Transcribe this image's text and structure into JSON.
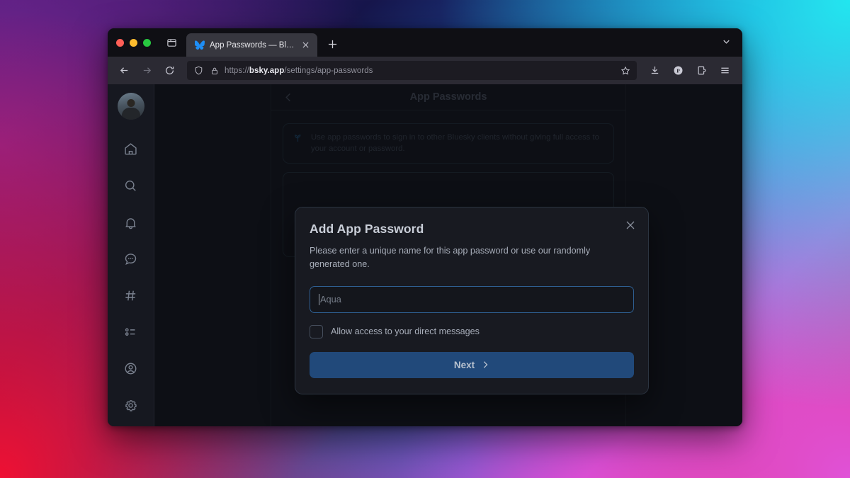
{
  "browser": {
    "traffic_lights": [
      "close",
      "minimize",
      "maximize"
    ],
    "sidebar_toggle_icon": "sidebar-panel-icon",
    "tab": {
      "favicon": "bluesky-butterfly-icon",
      "title": "App Passwords — Bluesky",
      "close_icon": "close-icon"
    },
    "new_tab_label": "+",
    "tab_list_icon": "chevron-down-icon",
    "nav": {
      "back_icon": "arrow-left-icon",
      "forward_icon": "arrow-right-icon",
      "reload_icon": "reload-icon"
    },
    "url": {
      "shield_icon": "shield-icon",
      "lock_icon": "lock-icon",
      "scheme": "https://",
      "host": "bsky.app",
      "path": "/settings/app-passwords",
      "bookmark_icon": "star-icon"
    },
    "toolbar_icons": [
      {
        "name": "download-icon",
        "glyph": "download"
      },
      {
        "name": "pocket-icon",
        "glyph": "P"
      },
      {
        "name": "extensions-icon",
        "glyph": "extension"
      },
      {
        "name": "app-menu-icon",
        "glyph": "hamburger"
      }
    ]
  },
  "sidebar": {
    "avatar_alt": "user-avatar",
    "items": [
      {
        "name": "sidebar-item-home",
        "icon": "home-icon"
      },
      {
        "name": "sidebar-item-search",
        "icon": "search-icon"
      },
      {
        "name": "sidebar-item-notifications",
        "icon": "bell-icon"
      },
      {
        "name": "sidebar-item-chat",
        "icon": "chat-bubble-icon"
      },
      {
        "name": "sidebar-item-feeds",
        "icon": "hashtag-icon"
      },
      {
        "name": "sidebar-item-lists",
        "icon": "list-icon"
      },
      {
        "name": "sidebar-item-profile",
        "icon": "person-circle-icon"
      },
      {
        "name": "sidebar-item-settings",
        "icon": "gear-icon"
      }
    ]
  },
  "page": {
    "back_icon": "chevron-left-icon",
    "title": "App Passwords",
    "info": {
      "icon": "sprout-icon",
      "text": "Use app passwords to sign in to other Bluesky clients without giving full access to your account or password."
    }
  },
  "dialog": {
    "title": "Add App Password",
    "close_icon": "close-icon",
    "description": "Please enter a unique name for this app password or use our randomly generated one.",
    "name_input": {
      "value": "",
      "placeholder": "Aqua",
      "focused": true
    },
    "checkbox": {
      "label": "Allow access to your direct messages",
      "checked": false
    },
    "next_button": {
      "label": "Next",
      "icon": "chevron-right-icon"
    }
  },
  "colors": {
    "accent_blue": "#21497a",
    "focus_ring": "#2e5f92",
    "window_bg": "#1c1b22",
    "page_bg": "#161820",
    "dialog_bg": "#181a21"
  }
}
